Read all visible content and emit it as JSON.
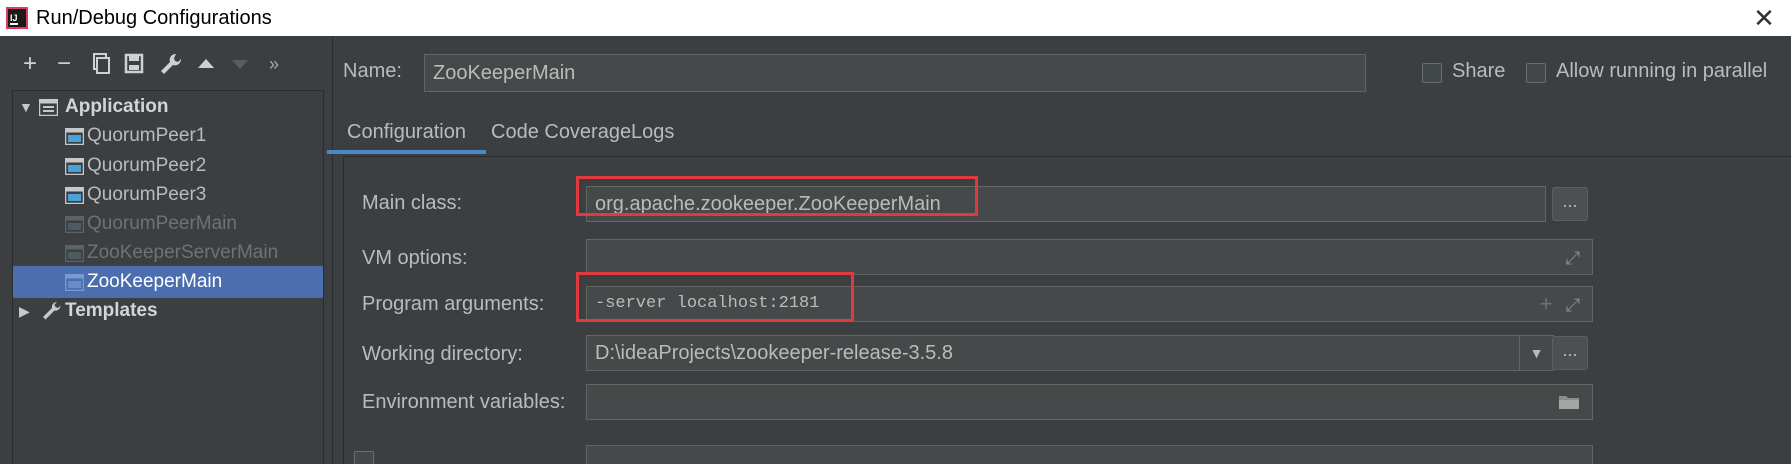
{
  "window": {
    "title": "Run/Debug Configurations",
    "close_glyph": "✕"
  },
  "toolbar": {
    "add": "+",
    "remove": "−",
    "copy": "⧉",
    "save": "▣",
    "edit": "🔧",
    "move_up": "▲",
    "move_down": "▼",
    "more": "»"
  },
  "tree": {
    "application": {
      "label": "Application",
      "arrow": "▼"
    },
    "items": [
      {
        "label": "QuorumPeer1",
        "state": "normal"
      },
      {
        "label": "QuorumPeer2",
        "state": "normal"
      },
      {
        "label": "QuorumPeer3",
        "state": "normal"
      },
      {
        "label": "QuorumPeerMain",
        "state": "temporary"
      },
      {
        "label": "ZooKeeperServerMain",
        "state": "temporary"
      },
      {
        "label": "ZooKeeperMain",
        "state": "selected"
      }
    ],
    "templates": {
      "label": "Templates",
      "arrow": "▶"
    }
  },
  "header": {
    "name_label": "Name:",
    "name_value": "ZooKeeperMain",
    "share_label": "Share",
    "parallel_label": "Allow running in parallel"
  },
  "tabs": [
    {
      "label": "Configuration",
      "active": true
    },
    {
      "label": "Code Coverage",
      "active": false
    },
    {
      "label": "Logs",
      "active": false
    }
  ],
  "form": {
    "main_class": {
      "label": "Main class:",
      "value": "org.apache.zookeeper.ZooKeeperMain"
    },
    "vm_options": {
      "label": "VM options:",
      "value": ""
    },
    "program_arguments": {
      "label": "Program arguments:",
      "value": "-server localhost:2181"
    },
    "working_directory": {
      "label": "Working directory:",
      "value": "D:\\ideaProjects\\zookeeper-release-3.5.8"
    },
    "environment_variables": {
      "label": "Environment variables:",
      "value": ""
    },
    "browse_button": "...",
    "expand_glyph": "⤢",
    "add_glyph": "+",
    "dropdown_glyph": "▼"
  },
  "colors": {
    "highlight": "#e0393e",
    "selection": "#4b6eaf",
    "tab_underline": "#4a88c7"
  }
}
